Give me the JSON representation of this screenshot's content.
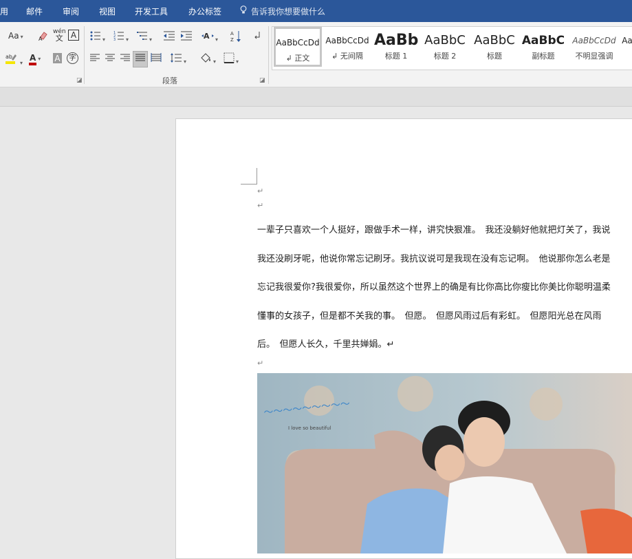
{
  "menu": {
    "tabs": [
      "用",
      "邮件",
      "审阅",
      "视图",
      "开发工具",
      "办公标签"
    ],
    "tell_me": "告诉我你想要做什么"
  },
  "ribbon": {
    "font_group": {
      "change_case": "Aa",
      "phonetic_top": "wén",
      "phonetic_bottom": "文",
      "char_border": "A",
      "font_color": "A",
      "char_shading": "A",
      "enclose": "字"
    },
    "paragraph_label": "段落",
    "styles": [
      {
        "sample": "AaBbCcDd",
        "name": "↲ 正文"
      },
      {
        "sample": "AaBbCcDd",
        "name": "↲ 无间隔"
      },
      {
        "sample": "AaBb",
        "name": "标题 1"
      },
      {
        "sample": "AaBbC",
        "name": "标题 2"
      },
      {
        "sample": "AaBbC",
        "name": "标题"
      },
      {
        "sample": "AaBbC",
        "name": "副标题"
      },
      {
        "sample": "AaBbCcDd",
        "name": "不明显强调"
      },
      {
        "sample": "Aa",
        "name": ""
      }
    ]
  },
  "document": {
    "empty_mark": "↵",
    "lines": [
      "一辈子只喜欢一个人挺好，跟做手术一样，讲究快狠准。　我还没躺好他就把灯关了，我说",
      "我还没刷牙呢，他说你常忘记刷牙。我抗议说可是我现在没有忘记啊。　他说那你怎么老是",
      "忘记我很爱你?我很爱你，所以虽然这个世界上的确是有比你高比你瘦比你美比你聪明温柔",
      "懂事的女孩子，但是都不关我的事。　但愿。　但愿风雨过后有彩虹。　但愿阳光总在风雨",
      "后。　但愿人长久，千里共婵娟。↵"
    ],
    "photo_caption": "I love so beautiful"
  },
  "colors": {
    "menubar": "#2b579a",
    "ribbon": "#f3f3f3",
    "page": "#ffffff",
    "workspace": "#e8e8e8"
  }
}
